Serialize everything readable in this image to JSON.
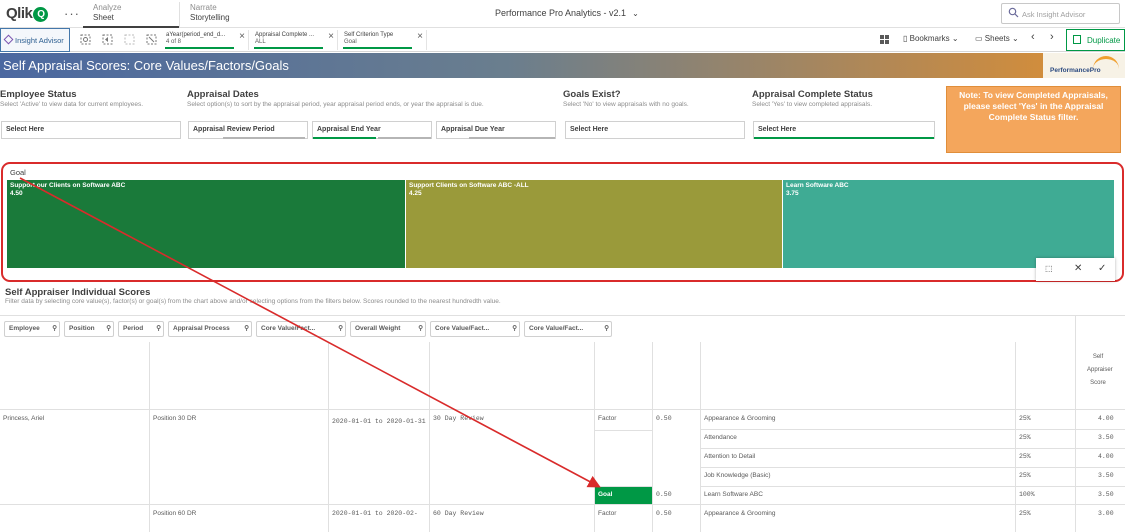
{
  "app": {
    "logo_text": "Qlik",
    "logo_q": "Q",
    "dots": "···",
    "nav_sheet_sub": "Analyze",
    "nav_sheet_main": "Sheet",
    "nav_story_sub": "Narrate",
    "nav_story_main": "Storytelling",
    "title": "Performance Pro Analytics - v2.1",
    "search_placeholder": "Ask Insight Advisor"
  },
  "selections": {
    "insight_label": "Insight Advisor",
    "chips": [
      {
        "field": "aYear(period_end_d...",
        "value": "4 of 8"
      },
      {
        "field": "Appraisal Complete ...",
        "value": "ALL"
      },
      {
        "field": "Self Criterion Type",
        "value": "Goal"
      }
    ],
    "bookmarks": "Bookmarks",
    "sheets": "Sheets",
    "duplicate": "Duplicate"
  },
  "header": {
    "title": "Self Appraisal Scores: Core Values/Factors/Goals",
    "brand": "PerformancePro"
  },
  "filters": [
    {
      "title": "Employee Status",
      "desc": "Select 'Active' to view data for current employees.",
      "boxes": [
        "Select Here"
      ]
    },
    {
      "title": "Appraisal Dates",
      "desc": "Select option(s) to sort by the appraisal period, year appraisal period ends, or year the appraisal is due.",
      "boxes": [
        "Appraisal Review Period",
        "Appraisal End Year",
        "Appraisal Due Year"
      ]
    },
    {
      "title": "Goals Exist?",
      "desc": "Select 'No' to view appraisals with no goals.",
      "boxes": [
        "Select Here"
      ]
    },
    {
      "title": "Appraisal Complete Status",
      "desc": "Select 'Yes' to view completed appraisals.",
      "boxes": [
        "Select Here"
      ]
    }
  ],
  "note": "Note: To view Completed Appraisals, please select 'Yes' in the Appraisal Complete Status filter.",
  "treemap": {
    "label": "Goal",
    "tiles": [
      {
        "name": "Support our Clients on Software ABC",
        "value": "4.50",
        "color": "#1a7a3a"
      },
      {
        "name": "Support Clients on Software ABC -ALL",
        "value": "4.25",
        "color": "#9a9a3a"
      },
      {
        "name": "Learn Software ABC",
        "value": "3.75",
        "color": "#3fab94"
      }
    ]
  },
  "table": {
    "title": "Self Appraiser Individual Scores",
    "subtitle": "Filter data by selecting core value(s), factor(s) or goal(s) from the chart above and/or selecting options from the filters below. Scores rounded to the nearest hundredth value.",
    "headers": [
      "Employee",
      "Position",
      "Period",
      "Appraisal Process",
      "Core Value/Fact...",
      "Overall Weight",
      "Core Value/Fact...",
      "Core Value/Fact..."
    ],
    "score_header": "Self Appraiser Score",
    "employee": "Princess, Ariel",
    "positions": [
      "Position 30 DR",
      "Position 60 DR"
    ],
    "periods": [
      "2020-01-01 to 2020-01-31",
      "2020-01-01 to 2020-02-"
    ],
    "processes": [
      "30 Day Review",
      "60 Day Review"
    ],
    "types": [
      "Factor",
      "Goal",
      "Factor"
    ],
    "weights": [
      "0.50",
      "0.50",
      "0.50"
    ],
    "rows": [
      {
        "name": "Appearance & Grooming",
        "pct": "25%",
        "score": "4.00"
      },
      {
        "name": "Attendance",
        "pct": "25%",
        "score": "3.50"
      },
      {
        "name": "Attention to Detail",
        "pct": "25%",
        "score": "4.00"
      },
      {
        "name": "Job Knowledge (Basic)",
        "pct": "25%",
        "score": "3.50"
      },
      {
        "name": "Learn Software ABC",
        "pct": "100%",
        "score": "3.50"
      },
      {
        "name": "Appearance & Grooming",
        "pct": "25%",
        "score": "3.00"
      }
    ]
  }
}
